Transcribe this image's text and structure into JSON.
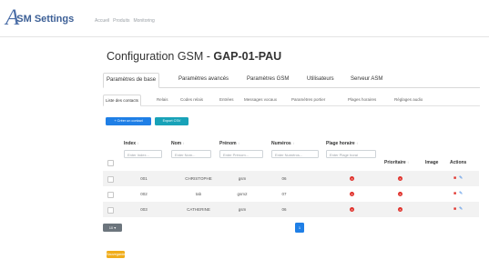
{
  "header": {
    "logo_letter": "A",
    "logo_text": "SM Settings",
    "nav": [
      "Accueil",
      "Produits",
      "Monitoring"
    ]
  },
  "page": {
    "title_prefix": "Configuration GSM - ",
    "title_name": "GAP-01-PAU"
  },
  "tabs": [
    "Paramètres de base",
    "Paramètres avancés",
    "Paramètres GSM",
    "Utilisateurs",
    "Serveur ASM"
  ],
  "subtabs": [
    "Liste des contacts",
    "Relais",
    "Codes relais",
    "Entrées",
    "Messages vocaux",
    "Paramètres portier",
    "Plages horaires",
    "Réglages audio"
  ],
  "buttons": {
    "create": "+ Créer un contact",
    "export": "Export CSV"
  },
  "table": {
    "headers": {
      "index": "Index",
      "nom": "Nom",
      "prenom": "Prénom",
      "numeros": "Numéros",
      "plage": "Plage horaire",
      "prioritaire": "Prioritaire",
      "image": "Image",
      "actions": "Actions",
      "sort_icon": "↕"
    },
    "filters": {
      "index": "Enter Index...",
      "nom": "Enter Nom...",
      "prenom": "Enter Prénom...",
      "numeros": "Enter Numéros...",
      "plage": "Enter Plage horai"
    },
    "rows": [
      {
        "index": "001",
        "nom": "CHRISTOPHE",
        "prenom": "gsm",
        "numeros": "06"
      },
      {
        "index": "002",
        "nom": "tab",
        "prenom": "gsm2",
        "numeros": "07"
      },
      {
        "index": "003",
        "nom": "CATHERINE",
        "prenom": "gsm",
        "numeros": "06"
      }
    ]
  },
  "pagination": {
    "page_size": "10 ▾",
    "current_page": "1"
  },
  "save_button": "Sauvegarder",
  "colors": {
    "primary": "#1f7fe6",
    "info": "#18a2b8",
    "danger": "#e0322c",
    "warning": "#f0ad1b",
    "secondary": "#6c757d"
  }
}
